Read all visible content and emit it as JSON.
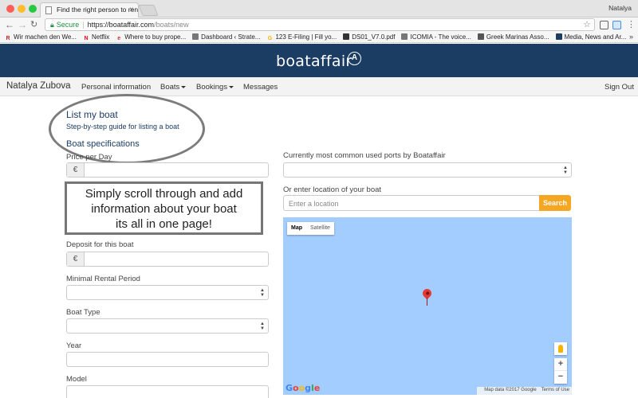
{
  "browser": {
    "tab_title": "Find the right person to rent y",
    "profile_name": "Natalya",
    "secure_label": "Secure",
    "url_host": "https://boataffair.com",
    "url_path": "/boats/new",
    "bookmarks": [
      {
        "label": "Wir machen den We...",
        "icon": "R",
        "color": "#c62828"
      },
      {
        "label": "Netflix",
        "icon": "N",
        "color": "#e50914"
      },
      {
        "label": "Where to buy prope...",
        "icon": "e",
        "color": "#d32f2f"
      },
      {
        "label": "Dashboard ‹ Strate...",
        "icon": "",
        "color": "#777777"
      },
      {
        "label": "123 E-Filing | Fill yo...",
        "icon": "G",
        "color": "#f4b400"
      },
      {
        "label": "DS01_V7.0.pdf",
        "icon": "",
        "color": "#333333"
      },
      {
        "label": "ICOMIA - The voice...",
        "icon": "",
        "color": "#777777"
      },
      {
        "label": "Greek Marinas Asso...",
        "icon": "",
        "color": "#555555"
      },
      {
        "label": "Media, News and Ar...",
        "icon": "",
        "color": "#1b3c63"
      }
    ],
    "bookmarks_more": "»"
  },
  "site": {
    "logo": "boataffair",
    "logo_mark": "A",
    "nav": {
      "user": "Natalya Zubova",
      "personal": "Personal information",
      "boats": "Boats",
      "bookings": "Bookings",
      "messages": "Messages",
      "sign_out": "Sign Out"
    }
  },
  "form": {
    "title": "List my boat",
    "subtitle": "Step-by-step guide for listing a boat",
    "section": "Boat specifications",
    "price_label": "Price per Day",
    "currency": "€",
    "deposit_label": "Deposit for this boat",
    "min_rental_label": "Minimal Rental Period",
    "boat_type_label": "Boat Type",
    "year_label": "Year",
    "model_label": "Model",
    "ports_label": "Currently most common used ports by Boataffair",
    "location_label": "Or enter location of your boat",
    "location_placeholder": "Enter a location",
    "search_button": "Search"
  },
  "callout": {
    "line1": "Simply scroll through and add",
    "line2": "information about your boat",
    "line3": "its all in one page!"
  },
  "map": {
    "type_map": "Map",
    "type_satellite": "Satellite",
    "zoom_in": "+",
    "zoom_out": "−",
    "google": "Google",
    "map_data": "Map data ©2017 Google",
    "terms": "Terms of Use"
  }
}
